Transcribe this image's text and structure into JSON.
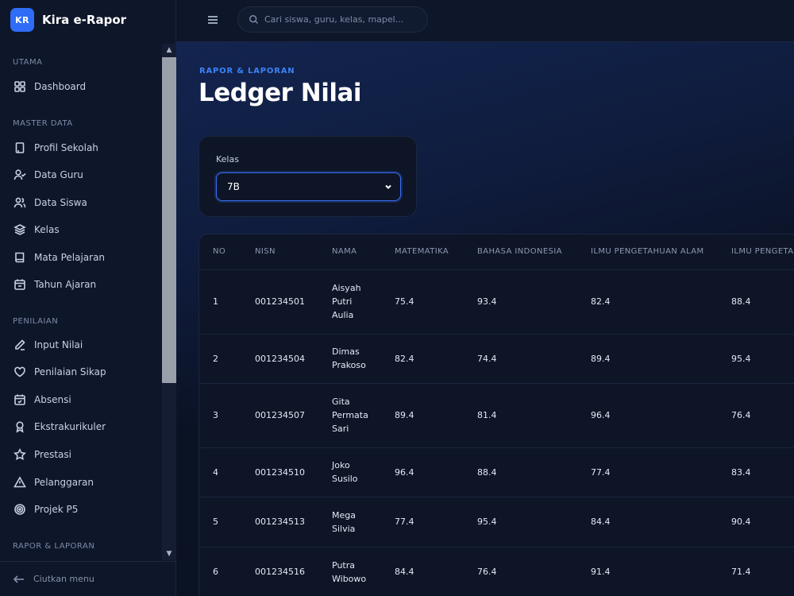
{
  "app": {
    "logo": "KR",
    "name": "Kira e-Rapor"
  },
  "sidebar": {
    "sections": [
      "UTAMA",
      "MASTER DATA",
      "PENILAIAN",
      "RAPOR & LAPORAN"
    ],
    "items": [
      {
        "label": "Dashboard",
        "icon": "grid-icon"
      },
      {
        "label": "Profil Sekolah",
        "icon": "building-icon"
      },
      {
        "label": "Data Guru",
        "icon": "user-check-icon"
      },
      {
        "label": "Data Siswa",
        "icon": "users-icon"
      },
      {
        "label": "Kelas",
        "icon": "layers-icon"
      },
      {
        "label": "Mata Pelajaran",
        "icon": "book-icon"
      },
      {
        "label": "Tahun Ajaran",
        "icon": "calendar-icon"
      },
      {
        "label": "Input Nilai",
        "icon": "pencil-icon"
      },
      {
        "label": "Penilaian Sikap",
        "icon": "heart-icon"
      },
      {
        "label": "Absensi",
        "icon": "calendar-check-icon"
      },
      {
        "label": "Ekstrakurikuler",
        "icon": "award-icon"
      },
      {
        "label": "Prestasi",
        "icon": "star-icon"
      },
      {
        "label": "Pelanggaran",
        "icon": "warning-icon"
      },
      {
        "label": "Projek P5",
        "icon": "target-icon"
      }
    ],
    "collapse_label": "Ciutkan menu"
  },
  "topbar": {
    "search_placeholder": "Cari siswa, guru, kelas, mapel..."
  },
  "page": {
    "eyebrow": "RAPOR & LAPORAN",
    "title": "Ledger Nilai"
  },
  "filter": {
    "label": "Kelas",
    "selected": "7B"
  },
  "table": {
    "headers": [
      "NO",
      "NISN",
      "NAMA",
      "MATEMATIKA",
      "BAHASA INDONESIA",
      "ILMU PENGETAHUAN ALAM",
      "ILMU PENGETA"
    ],
    "rows": [
      {
        "no": "1",
        "nisn": "001234501",
        "name": [
          "Aisyah",
          "Putri",
          "Aulia"
        ],
        "mtk": "75.4",
        "bind": "93.4",
        "ipa": "82.4",
        "ips": "88.4"
      },
      {
        "no": "2",
        "nisn": "001234504",
        "name": [
          "Dimas",
          "Prakoso"
        ],
        "mtk": "82.4",
        "bind": "74.4",
        "ipa": "89.4",
        "ips": "95.4"
      },
      {
        "no": "3",
        "nisn": "001234507",
        "name": [
          "Gita",
          "Permata",
          "Sari"
        ],
        "mtk": "89.4",
        "bind": "81.4",
        "ipa": "96.4",
        "ips": "76.4"
      },
      {
        "no": "4",
        "nisn": "001234510",
        "name": [
          "Joko",
          "Susilo"
        ],
        "mtk": "96.4",
        "bind": "88.4",
        "ipa": "77.4",
        "ips": "83.4"
      },
      {
        "no": "5",
        "nisn": "001234513",
        "name": [
          "Mega",
          "Silvia"
        ],
        "mtk": "77.4",
        "bind": "95.4",
        "ipa": "84.4",
        "ips": "90.4"
      },
      {
        "no": "6",
        "nisn": "001234516",
        "name": [
          "Putra",
          "Wibowo"
        ],
        "mtk": "84.4",
        "bind": "76.4",
        "ipa": "91.4",
        "ips": "71.4"
      }
    ]
  },
  "colors": {
    "accent": "#2f6df6",
    "eyebrow": "#3b82f6",
    "background": "#0b1224"
  }
}
